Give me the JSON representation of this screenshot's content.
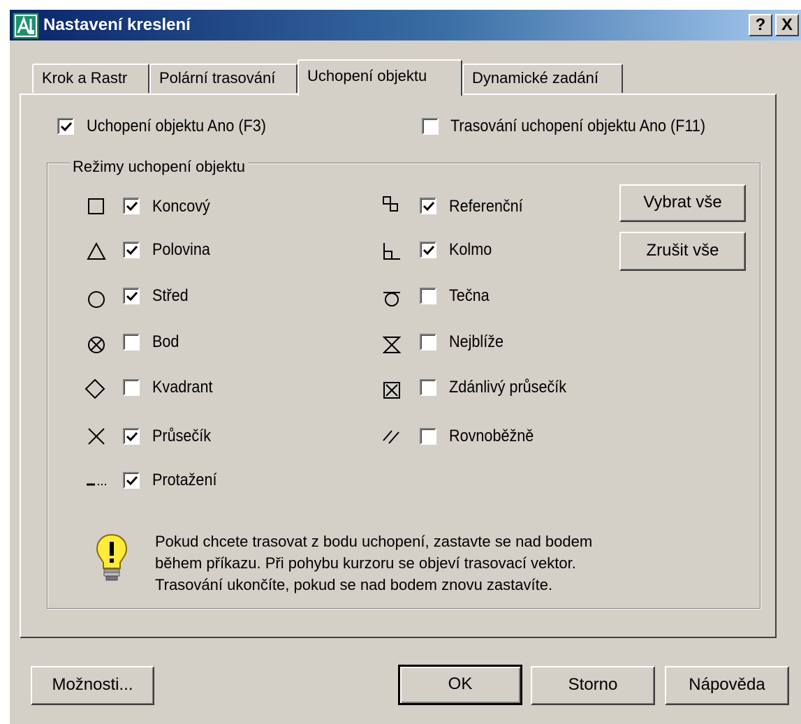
{
  "window": {
    "title": "Nastavení kreslení",
    "help_button": "?",
    "close_button": "X"
  },
  "tabs": [
    {
      "label": "Krok a Rastr",
      "active": false
    },
    {
      "label": "Polární trasování",
      "active": false
    },
    {
      "label": "Uchopení objektu",
      "active": true
    },
    {
      "label": "Dynamické zadání",
      "active": false
    }
  ],
  "top_options": {
    "osnap_on": {
      "label": "Uchopení objektu Ano (F3)",
      "checked": true
    },
    "otrack_on": {
      "label": "Trasování uchopení objektu Ano (F11)",
      "checked": false
    }
  },
  "snap_modes": {
    "group_title": "Režimy uchopení objektu",
    "left": [
      {
        "label": "Koncový",
        "checked": true,
        "icon": "endpoint-square-icon"
      },
      {
        "label": "Polovina",
        "checked": true,
        "icon": "midpoint-triangle-icon"
      },
      {
        "label": "Střed",
        "checked": true,
        "icon": "center-circle-icon"
      },
      {
        "label": "Bod",
        "checked": false,
        "icon": "node-icon"
      },
      {
        "label": "Kvadrant",
        "checked": false,
        "icon": "quadrant-diamond-icon"
      },
      {
        "label": "Průsečík",
        "checked": true,
        "icon": "intersection-x-icon"
      },
      {
        "label": "Protažení",
        "checked": true,
        "icon": "extension-icon"
      }
    ],
    "right": [
      {
        "label": "Referenční",
        "checked": true,
        "icon": "insertion-icon"
      },
      {
        "label": "Kolmo",
        "checked": true,
        "icon": "perpendicular-icon"
      },
      {
        "label": "Tečna",
        "checked": false,
        "icon": "tangent-icon"
      },
      {
        "label": "Nejblíže",
        "checked": false,
        "icon": "nearest-hourglass-icon"
      },
      {
        "label": "Zdánlivý průsečík",
        "checked": false,
        "icon": "apparent-intersection-icon"
      },
      {
        "label": "Rovnoběžně",
        "checked": false,
        "icon": "parallel-icon"
      }
    ],
    "select_all": "Vybrat vše",
    "clear_all": "Zrušit vše"
  },
  "hint": {
    "icon": "lightbulb-icon",
    "lines": [
      "Pokud chcete trasovat z bodu uchopení, zastavte se nad bodem",
      "během příkazu. Při pohybu kurzoru se objeví trasovací vektor.",
      "Trasování ukončíte, pokud se nad bodem znovu zastavíte."
    ]
  },
  "footer": {
    "options": "Možnosti...",
    "ok": "OK",
    "cancel": "Storno",
    "help": "Nápověda"
  }
}
